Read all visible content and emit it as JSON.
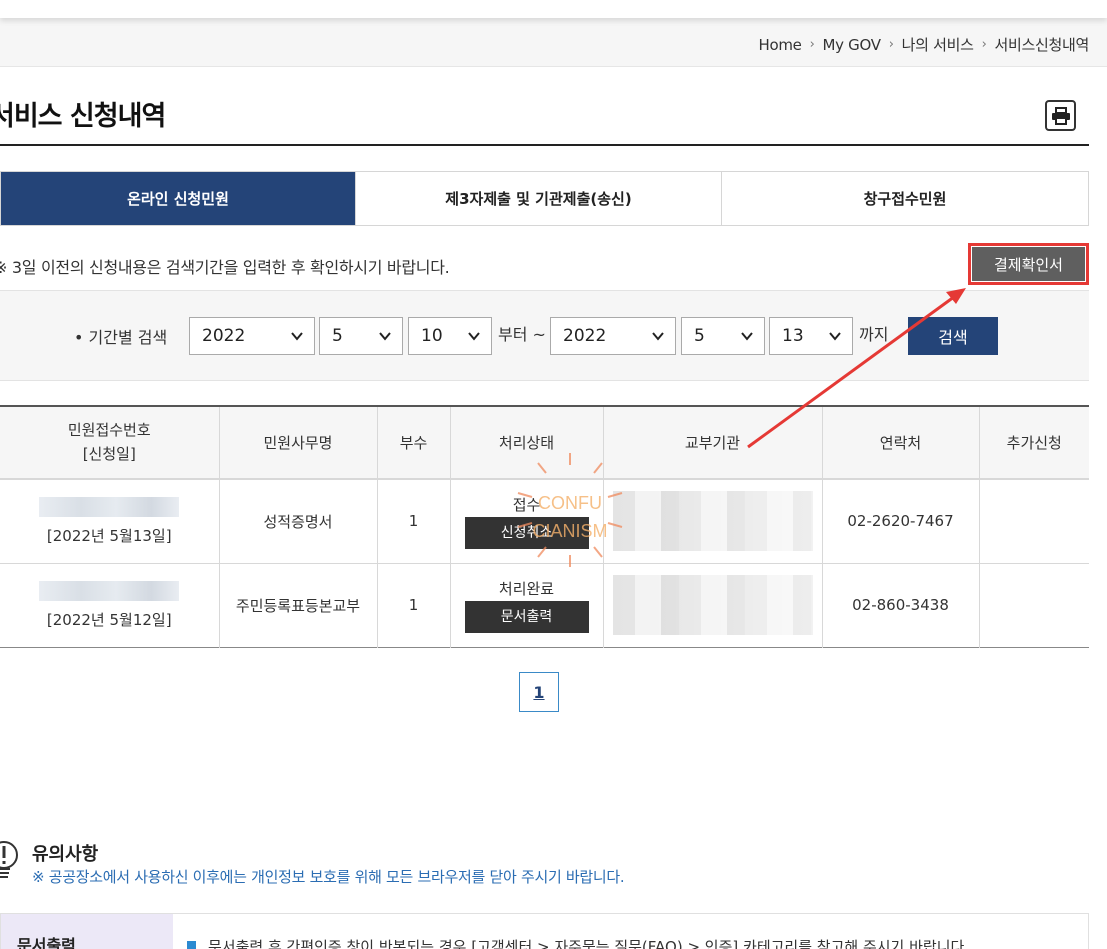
{
  "breadcrumb": [
    "Home",
    "My GOV",
    "나의 서비스",
    "서비스신청내역"
  ],
  "page_title": "서비스 신청내역",
  "print_icon": "print-icon",
  "tabs": [
    {
      "label": "온라인 신청민원",
      "active": true
    },
    {
      "label": "제3자제출 및 기관제출(송신)",
      "active": false
    },
    {
      "label": "창구접수민원",
      "active": false
    }
  ],
  "notice": "※ 3일 이전의 신청내용은 검색기간을 입력한 후 확인하시기 바랍니다.",
  "receipt_button": "결제확인서",
  "search": {
    "label": "• 기간별 검색",
    "from_year": "2022",
    "from_month": "5",
    "from_day": "10",
    "from_text": "부터 ~",
    "to_year": "2022",
    "to_month": "5",
    "to_day": "13",
    "to_text": "까지",
    "button": "검색"
  },
  "table": {
    "headers": [
      "민원접수번호",
      "[신청일]",
      "민원사무명",
      "부수",
      "처리상태",
      "교부기관",
      "연락처",
      "추가신청"
    ],
    "rows": [
      {
        "date": "[2022년 5월13일]",
        "name": "성적증명서",
        "count": "1",
        "status": "접수",
        "action": "신청취소",
        "phone": "02-2620-7467"
      },
      {
        "date": "[2022년 5월12일]",
        "name": "주민등록표등본교부",
        "count": "1",
        "status": "처리완료",
        "action": "문서출력",
        "phone": "02-860-3438"
      }
    ]
  },
  "watermark": {
    "line1": "CONFU",
    "line2": "CIANISM"
  },
  "pagination": {
    "current": "1"
  },
  "caution": {
    "title": "유의사항",
    "text": "※ 공공장소에서 사용하신 이후에는 개인정보 보호를 위해 모든 브라우저를 닫아 주시기 바랍니다."
  },
  "info": {
    "head": "문서출력",
    "text": "문서출력 후 간편인증 창이 반복되는 경우 [고객센터 > 자주묻는 질문(FAQ) > 인증] 카테고리를 참고해 주시기 바랍니다."
  },
  "colors": {
    "primary": "#244478",
    "highlight": "#e53935",
    "link": "#2b6db3"
  }
}
